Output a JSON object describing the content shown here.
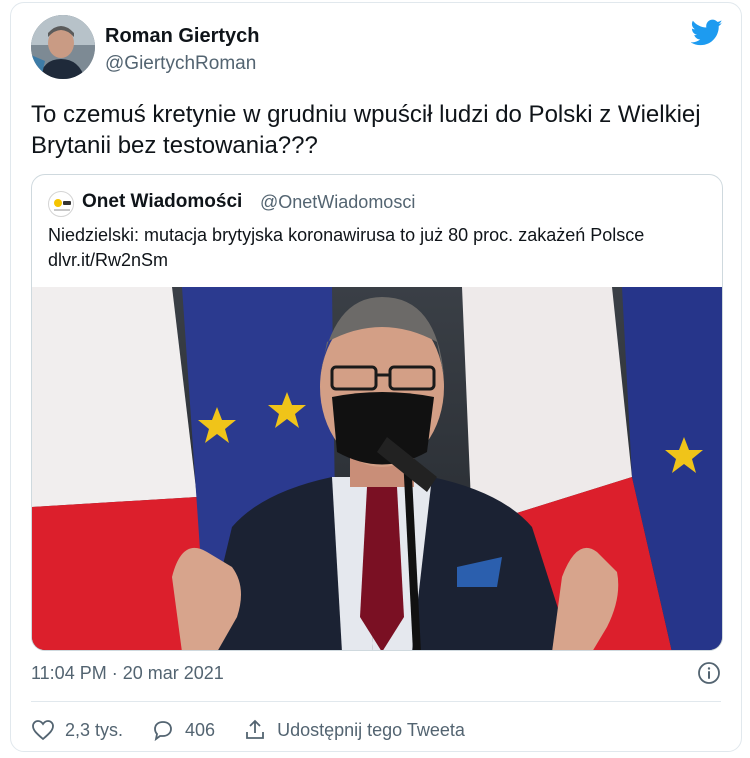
{
  "author": {
    "name": "Roman Giertych",
    "handle": "@GiertychRoman"
  },
  "tweet": {
    "text": "To czemuś kretynie w grudniu wpuścił ludzi do Polski z Wielkiej Brytanii bez testowania???"
  },
  "quoted": {
    "name": "Onet Wiadomości",
    "handle": "@OnetWiadomosci",
    "text": "Niedzielski: mutacja brytyjska koronawirusa to już 80 proc. zakażeń Polsce dlvr.it/Rw2nSm"
  },
  "meta": {
    "timestamp": "11:04 PM · 20 mar 2021"
  },
  "actions": {
    "likes": "2,3 tys.",
    "replies": "406",
    "share_label": "Udostępnij tego Tweeta"
  },
  "colors": {
    "twitter_blue": "#1d9bf0",
    "text_secondary": "#536471",
    "border": "#cfd9de"
  },
  "icons": {
    "brand": "twitter-bird-icon",
    "info": "info-icon",
    "like": "heart-icon",
    "reply": "speech-bubble-icon",
    "share": "share-upload-icon"
  }
}
